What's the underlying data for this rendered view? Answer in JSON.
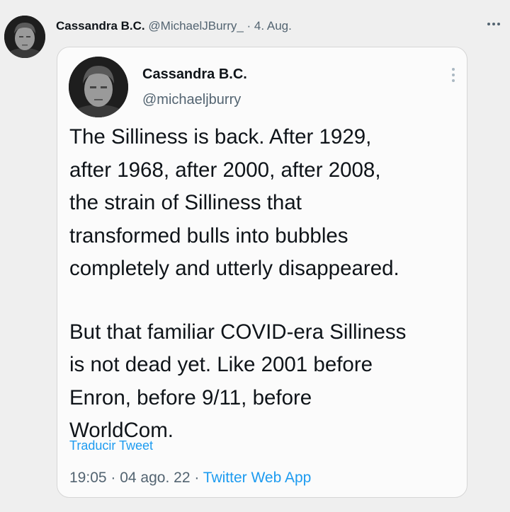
{
  "outer_tweet": {
    "name": "Cassandra B.C.",
    "handle": "@MichaelJBurry_",
    "separator": " · ",
    "date": "4. Aug.",
    "more_icon": "more-horizontal-icon"
  },
  "quoted_tweet": {
    "name": "Cassandra B.C.",
    "handle": "@michaeljburry",
    "menu_icon": "more-vertical-icon",
    "paragraphs": [
      [
        "The Silliness is back. After 1929,",
        "after 1968, after 2000, after 2008,",
        "the strain of Silliness that",
        "transformed bulls into bubbles",
        "completely and utterly disappeared."
      ],
      [
        "But that familiar COVID-era Silliness",
        "is not dead yet. Like 2001 before",
        "Enron, before 9/11, before",
        "WorldCom."
      ]
    ],
    "translate_label": "Traducir Tweet",
    "time": "19:05",
    "meta_sep": " · ",
    "date": "04 ago. 22",
    "source": "Twitter Web App"
  },
  "colors": {
    "link": "#1d9bf0",
    "secondary_text": "#536471",
    "primary_text": "#0f1419"
  }
}
